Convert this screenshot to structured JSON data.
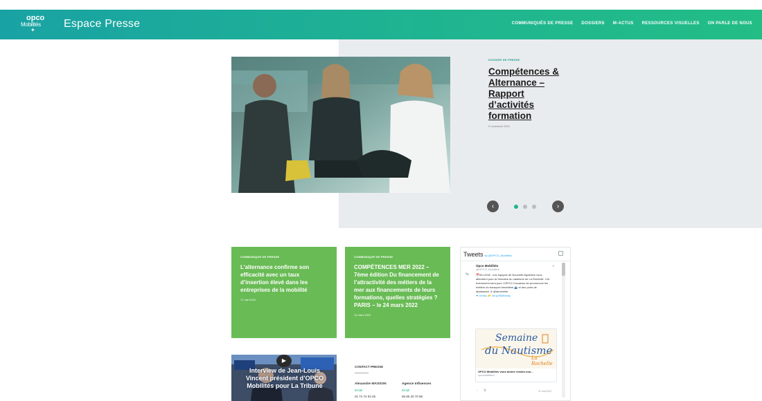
{
  "header": {
    "logo_text": "Mobilités",
    "logo_mark": "opco",
    "title": "Espace Presse",
    "nav": [
      "COMMUNIQUÉS DE PRESSE",
      "DOSSIERS",
      "M-ACTUS",
      "RESSOURCES VISUELLES",
      "ON PARLE DE NOUS"
    ],
    "colors": {
      "start": "#19a2a4",
      "end": "#23bd86"
    }
  },
  "hero": {
    "kicker": "DOSSIER DE PRESSE",
    "title": "Compétences & Alternance – Rapport d’activités formation",
    "date": "9 novembre 2021",
    "slides": 3,
    "active_slide": 1,
    "prev_icon": "chevron-left-icon",
    "next_icon": "chevron-right-icon"
  },
  "cards": [
    {
      "kicker": "COMMUNIQUÉ DE PRESSE",
      "title": "L’alternance confirme son efficacité avec un taux d’insertion élevé dans les entreprises de la mobilité",
      "date": "17 mai 2022"
    },
    {
      "kicker": "COMMUNIQUÉ DE PRESSE",
      "title": "COMPÉTENCES MER 2022 – 7ème édition Du financement de l’attractivité des métiers de la mer aux financements de leurs formations, quelles stratégies ? PARIS – le 24 mars 2022",
      "date": "14 mars 2022"
    }
  ],
  "video": {
    "caption": "Interview de Jean-Louis Vincent président d’OPCO Mobilités pour La Tribune",
    "logo": "Mobilités"
  },
  "contact": {
    "heading": "CONTACT PRESSE",
    "people": [
      {
        "name": "Alexandre MASSON",
        "email": "Email",
        "phone": "01 74 74 03 25"
      },
      {
        "name": "Agence Influences",
        "email": "Email",
        "phone": "06 80 20 70 88"
      }
    ]
  },
  "tweets": {
    "heading": "Tweets",
    "by": "by @OPCO_Mobilites",
    "author": "Opco Mobilités",
    "handle": "@OPCO_Mobilites",
    "body": "📅06-12/06 : nos équipes de Nouvelle-Aquitaine vous attendent pour la Semaine du nautisme de La Rochelle. Cet événement sera pour l’OPCO l’occasion de promouvoir les métiers du transport #maritime ⛴️ et des ports de #plaisance ⚓ @larochelle",
    "body_link": "➡ d’infos 👉 bit.ly/3NWsnby",
    "card_title1": "Semaine",
    "card_title2": "du Nautisme",
    "card_title3": "La Rochelle",
    "card_caption": "OPCO Mobilités vous donne rendez-vou...",
    "card_url": "opcomobilites.fr",
    "date": "31 mai 2022"
  }
}
